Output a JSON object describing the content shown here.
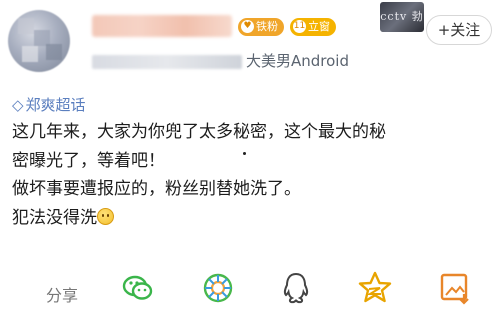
{
  "header": {
    "badges": [
      {
        "icon": "heart-coin-icon",
        "label": "铁粉",
        "color": "#f0a52a"
      },
      {
        "icon": "level-icon",
        "label": "立窗",
        "color": "#f5b300"
      }
    ],
    "vip_image_text": "cctv 勃博",
    "follow_button": "+关注",
    "source": "大美男Android"
  },
  "topic": {
    "icon": "diamond-topic-icon",
    "label": "郑爽超话"
  },
  "post": {
    "lines": [
      "这几年来，大家为你兜了太多秘密，这个最大的秘",
      "密曝光了，等着吧！",
      "做坏事要遭报应的，粉丝别替她洗了。",
      "犯法没得洗"
    ],
    "emoji": "smile-emoji-icon"
  },
  "actions": {
    "share_label": "分享",
    "items": [
      "wechat-icon",
      "moments-icon",
      "qq-icon",
      "qzone-star-icon",
      "save-image-icon"
    ],
    "accent": "#e8a400"
  }
}
